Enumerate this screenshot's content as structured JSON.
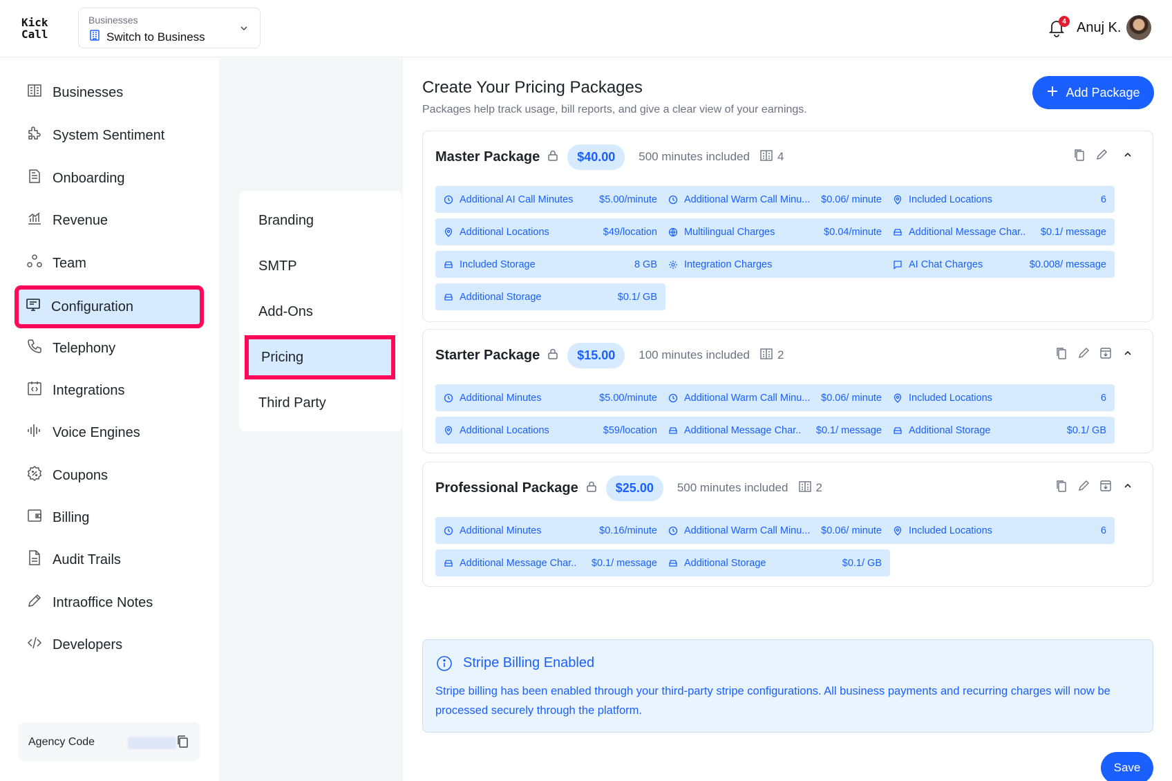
{
  "app": {
    "logo_line1": "Kick",
    "logo_line2": "Call"
  },
  "header": {
    "switcher_label": "Businesses",
    "switcher_value": "Switch to Business",
    "notification_count": "4",
    "user_name": "Anuj K."
  },
  "sidebar": {
    "items": [
      {
        "label": "Businesses",
        "icon": "building-icon"
      },
      {
        "label": "System Sentiment",
        "icon": "puzzle-icon"
      },
      {
        "label": "Onboarding",
        "icon": "document-icon"
      },
      {
        "label": "Revenue",
        "icon": "chart-icon"
      },
      {
        "label": "Team",
        "icon": "team-icon"
      },
      {
        "label": "Configuration",
        "icon": "config-icon",
        "active": true
      },
      {
        "label": "Telephony",
        "icon": "phone-icon"
      },
      {
        "label": "Integrations",
        "icon": "code-box-icon"
      },
      {
        "label": "Voice Engines",
        "icon": "waveform-icon"
      },
      {
        "label": "Coupons",
        "icon": "coupon-icon"
      },
      {
        "label": "Billing",
        "icon": "wallet-icon"
      },
      {
        "label": "Audit Trails",
        "icon": "file-icon"
      },
      {
        "label": "Intraoffice Notes",
        "icon": "pencil-icon"
      },
      {
        "label": "Developers",
        "icon": "code-icon"
      }
    ],
    "agency_label": "Agency Code"
  },
  "subnav": {
    "items": [
      "Branding",
      "SMTP",
      "Add-Ons",
      "Pricing",
      "Third Party"
    ],
    "active": "Pricing"
  },
  "page": {
    "title": "Create Your Pricing Packages",
    "subtitle": "Packages help track usage, bill reports, and give a clear view of your earnings.",
    "add_button": "Add Package",
    "save_button": "Save"
  },
  "packages": [
    {
      "name": "Master Package",
      "price": "$40.00",
      "minutes": "500 minutes included",
      "locations": "4",
      "chips": [
        {
          "label": "Additional AI Call Minutes",
          "value": "$5.00/minute",
          "icon": "clock-icon"
        },
        {
          "label": "Additional Warm Call Minu...",
          "value": "$0.06/ minute",
          "icon": "clock-icon"
        },
        {
          "label": "Included Locations",
          "value": "6",
          "icon": "pin-icon"
        },
        {
          "label": "Additional Locations",
          "value": "$49/location",
          "icon": "pin-icon"
        },
        {
          "label": "Multilingual Charges",
          "value": "$0.04/minute",
          "icon": "globe-icon"
        },
        {
          "label": "Additional Message Char..",
          "value": "$0.1/ message",
          "icon": "storage-icon"
        },
        {
          "label": "Included Storage",
          "value": "8 GB",
          "icon": "storage-icon"
        },
        {
          "label": "Integration Charges",
          "value": "",
          "icon": "gear-icon"
        },
        {
          "label": "AI Chat Charges",
          "value": "$0.008/ message",
          "icon": "chat-icon"
        },
        {
          "label": "Additional Storage",
          "value": "$0.1/ GB",
          "icon": "storage-icon"
        }
      ]
    },
    {
      "name": "Starter Package",
      "price": "$15.00",
      "minutes": "100 minutes included",
      "locations": "2",
      "chips": [
        {
          "label": "Additional Minutes",
          "value": "$5.00/minute",
          "icon": "clock-icon"
        },
        {
          "label": "Additional Warm Call Minu...",
          "value": "$0.06/ minute",
          "icon": "clock-icon"
        },
        {
          "label": "Included Locations",
          "value": "6",
          "icon": "pin-icon"
        },
        {
          "label": "Additional Locations",
          "value": "$59/location",
          "icon": "pin-icon"
        },
        {
          "label": "Additional Message Char..",
          "value": "$0.1/ message",
          "icon": "storage-icon"
        },
        {
          "label": "Additional Storage",
          "value": "$0.1/ GB",
          "icon": "storage-icon"
        }
      ]
    },
    {
      "name": "Professional Package",
      "price": "$25.00",
      "minutes": "500 minutes included",
      "locations": "2",
      "chips": [
        {
          "label": "Additional Minutes",
          "value": "$0.16/minute",
          "icon": "clock-icon"
        },
        {
          "label": "Additional Warm Call Minu...",
          "value": "$0.06/ minute",
          "icon": "clock-icon"
        },
        {
          "label": "Included Locations",
          "value": "6",
          "icon": "pin-icon"
        },
        {
          "label": "Additional Message Char..",
          "value": "$0.1/ message",
          "icon": "storage-icon"
        },
        {
          "label": "Additional Storage",
          "value": "$0.1/ GB",
          "icon": "storage-icon"
        }
      ]
    }
  ],
  "stripe": {
    "title": "Stripe Billing Enabled",
    "body": "Stripe billing has been enabled through your third-party stripe configurations. All business payments and recurring charges will now be processed securely through the platform."
  },
  "colors": {
    "accent": "#1a5fff",
    "chip_bg": "#d6ebff",
    "highlight": "#ff0a57"
  }
}
